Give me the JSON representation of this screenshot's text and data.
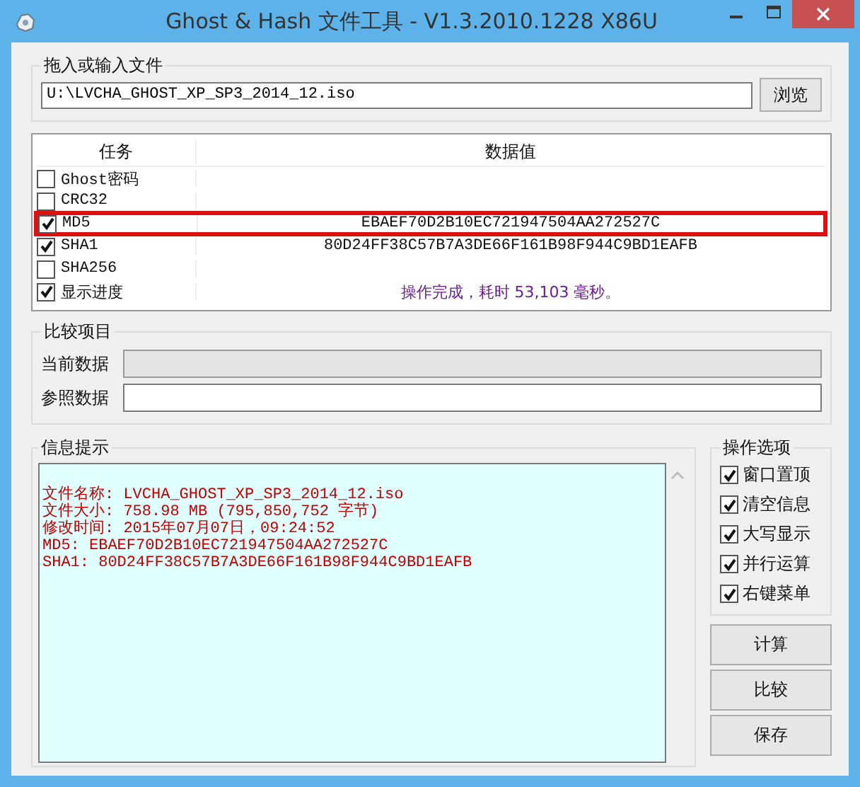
{
  "window": {
    "title": "Ghost & Hash 文件工具 - V1.3.2010.1228 X86U"
  },
  "file_group": {
    "label": "拖入或输入文件",
    "value": "U:\\LVCHA_GHOST_XP_SP3_2014_12.iso",
    "browse_button": "浏览"
  },
  "table": {
    "columns": [
      "任务",
      "数据值"
    ],
    "rows": [
      {
        "task": "Ghost密码",
        "checked": false,
        "selected": false
      },
      {
        "task": "CRC32",
        "checked": false,
        "selected": false
      },
      {
        "task": "MD5",
        "checked": true,
        "selected": true,
        "kind": "hash",
        "value": "EBAEF70D2B10EC721947504AA272527C"
      },
      {
        "task": "SHA1",
        "checked": true,
        "selected": false,
        "kind": "hash",
        "value": "80D24FF38C57B7A3DE66F161B98F944C9BD1EAFB"
      },
      {
        "task": "SHA256",
        "checked": false,
        "selected": false
      },
      {
        "task": "显示进度",
        "checked": true,
        "selected": false,
        "kind": "status",
        "value": "操作完成，耗时 53,103 毫秒。"
      }
    ]
  },
  "compare_group": {
    "label": "比较项目",
    "fields": [
      {
        "label": "当前数据",
        "disabled": true
      },
      {
        "label": "参照数据",
        "disabled": false
      }
    ]
  },
  "info_group": {
    "label": "信息提示",
    "lines": [
      "文件名称: LVCHA_GHOST_XP_SP3_2014_12.iso",
      "文件大小: 758.98 MB (795,850,752 字节)",
      "修改时间: 2015年07月07日，09:24:52",
      "MD5: EBAEF70D2B10EC721947504AA272527C",
      "SHA1: 80D24FF38C57B7A3DE66F161B98F944C9BD1EAFB"
    ]
  },
  "options_group": {
    "label": "操作选项",
    "options": [
      {
        "label": "窗口置顶",
        "checked": true
      },
      {
        "label": "清空信息",
        "checked": true
      },
      {
        "label": "大写显示",
        "checked": true
      },
      {
        "label": "并行运算",
        "checked": true
      },
      {
        "label": "右键菜单",
        "checked": true
      }
    ]
  },
  "buttons": [
    "计算",
    "比较",
    "保存"
  ]
}
